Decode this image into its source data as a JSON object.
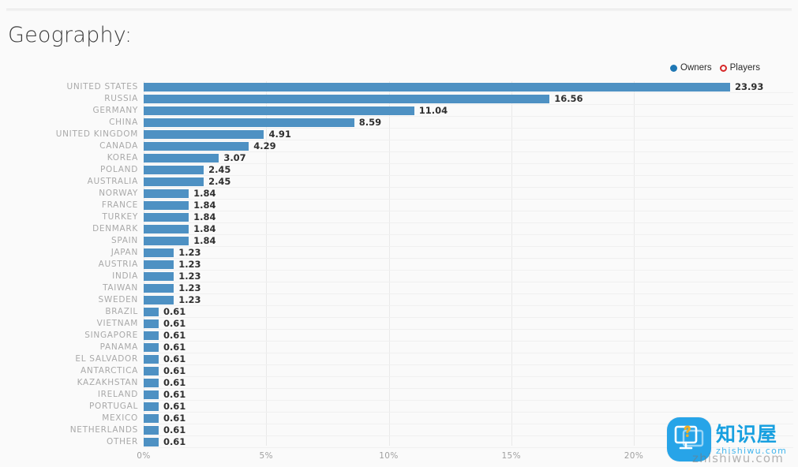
{
  "page": {
    "title": "Geography:"
  },
  "legend": {
    "items": [
      {
        "label": "Owners",
        "style": "filled",
        "color": "#1f77b4"
      },
      {
        "label": "Players",
        "style": "hollow",
        "color": "#d62728"
      }
    ]
  },
  "watermark": {
    "cn_text": "知识屋",
    "url": "zhishiwu.com",
    "ghost_url": "zhishiwu.com",
    "badge_color": "#27a4e8",
    "icon": "monitor-question-icon"
  },
  "colors": {
    "bar": "#4e91c3",
    "background": "#fafafa",
    "label": "#a9a9a9",
    "value": "#2f2f2f",
    "gridline": "#e9e9e9"
  },
  "chart_data": {
    "type": "bar",
    "orientation": "horizontal",
    "title": "Geography:",
    "xlabel": "",
    "ylabel": "",
    "xlim": [
      0,
      26.5
    ],
    "grid": true,
    "legend_position": "top-right",
    "xticks": [
      "0%",
      "5%",
      "10%",
      "15%",
      "20%"
    ],
    "xtick_values": [
      0,
      5,
      10,
      15,
      20
    ],
    "series": [
      {
        "name": "Owners",
        "color": "#4e91c3",
        "values": [
          23.93,
          16.56,
          11.04,
          8.59,
          4.91,
          4.29,
          3.07,
          2.45,
          2.45,
          1.84,
          1.84,
          1.84,
          1.84,
          1.84,
          1.23,
          1.23,
          1.23,
          1.23,
          1.23,
          0.61,
          0.61,
          0.61,
          0.61,
          0.61,
          0.61,
          0.61,
          0.61,
          0.61,
          0.61,
          0.61,
          0.61
        ]
      },
      {
        "name": "Players",
        "color": "#d62728",
        "values": []
      }
    ],
    "categories": [
      "UNITED STATES",
      "RUSSIA",
      "GERMANY",
      "CHINA",
      "UNITED KINGDOM",
      "CANADA",
      "KOREA",
      "POLAND",
      "AUSTRALIA",
      "NORWAY",
      "FRANCE",
      "TURKEY",
      "DENMARK",
      "SPAIN",
      "JAPAN",
      "AUSTRIA",
      "INDIA",
      "TAIWAN",
      "SWEDEN",
      "BRAZIL",
      "VIETNAM",
      "SINGAPORE",
      "PANAMA",
      "EL SALVADOR",
      "ANTARCTICA",
      "KAZAKHSTAN",
      "IRELAND",
      "PORTUGAL",
      "MEXICO",
      "NETHERLANDS",
      "OTHER"
    ],
    "value_labels": [
      "23.93",
      "16.56",
      "11.04",
      "8.59",
      "4.91",
      "4.29",
      "3.07",
      "2.45",
      "2.45",
      "1.84",
      "1.84",
      "1.84",
      "1.84",
      "1.84",
      "1.23",
      "1.23",
      "1.23",
      "1.23",
      "1.23",
      "0.61",
      "0.61",
      "0.61",
      "0.61",
      "0.61",
      "0.61",
      "0.61",
      "0.61",
      "0.61",
      "0.61",
      "0.61",
      "0.61"
    ]
  }
}
